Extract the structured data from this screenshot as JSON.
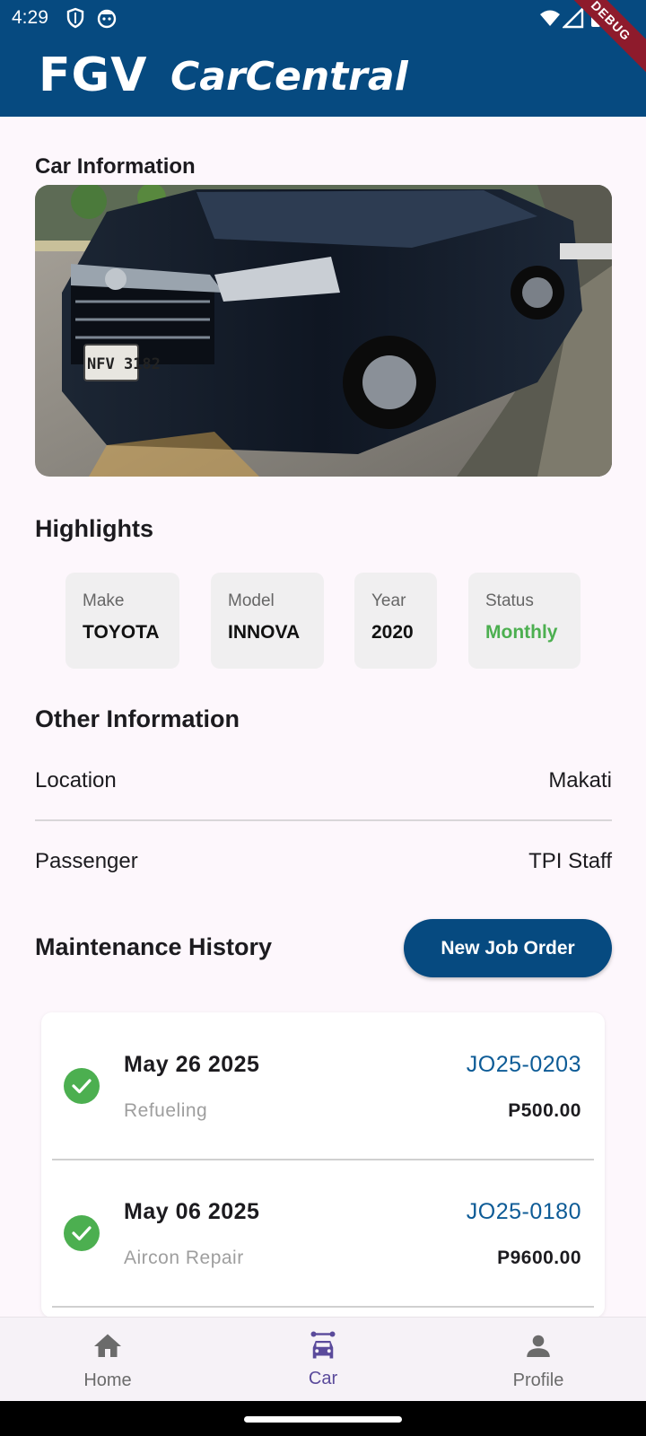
{
  "status_bar": {
    "time": "4:29",
    "debug_label": "DEBUG"
  },
  "app_bar": {
    "logo_brand": "FGV",
    "logo_product": "CarCentral"
  },
  "car_info": {
    "section_title": "Car Information",
    "plate_visible": "NFV 3182"
  },
  "highlights": {
    "section_title": "Highlights",
    "items": [
      {
        "label": "Make",
        "value": "TOYOTA"
      },
      {
        "label": "Model",
        "value": "INNOVA"
      },
      {
        "label": "Year",
        "value": "2020"
      },
      {
        "label": "Status",
        "value": "Monthly",
        "color": "#4caf50"
      }
    ]
  },
  "other_info": {
    "section_title": "Other Information",
    "rows": [
      {
        "key": "Location",
        "value": "Makati"
      },
      {
        "key": "Passenger",
        "value": "TPI Staff"
      }
    ]
  },
  "maintenance": {
    "section_title": "Maintenance History",
    "new_job_button": "New Job Order",
    "entries": [
      {
        "date": "May 26 2025",
        "type": "Refueling",
        "job_order": "JO25-0203",
        "amount": "P500.00",
        "status_icon": "check-circle-icon"
      },
      {
        "date": "May 06 2025",
        "type": "Aircon Repair",
        "job_order": "JO25-0180",
        "amount": "P9600.00",
        "status_icon": "check-circle-icon"
      }
    ]
  },
  "bottom_nav": {
    "items": [
      {
        "label": "Home",
        "icon": "home-icon",
        "active": false
      },
      {
        "label": "Car",
        "icon": "car-icon",
        "active": true
      },
      {
        "label": "Profile",
        "icon": "person-icon",
        "active": false
      }
    ]
  },
  "colors": {
    "primary": "#064a80",
    "accent_nav": "#5a4a9b",
    "success": "#4caf50",
    "link": "#0d5b96"
  }
}
